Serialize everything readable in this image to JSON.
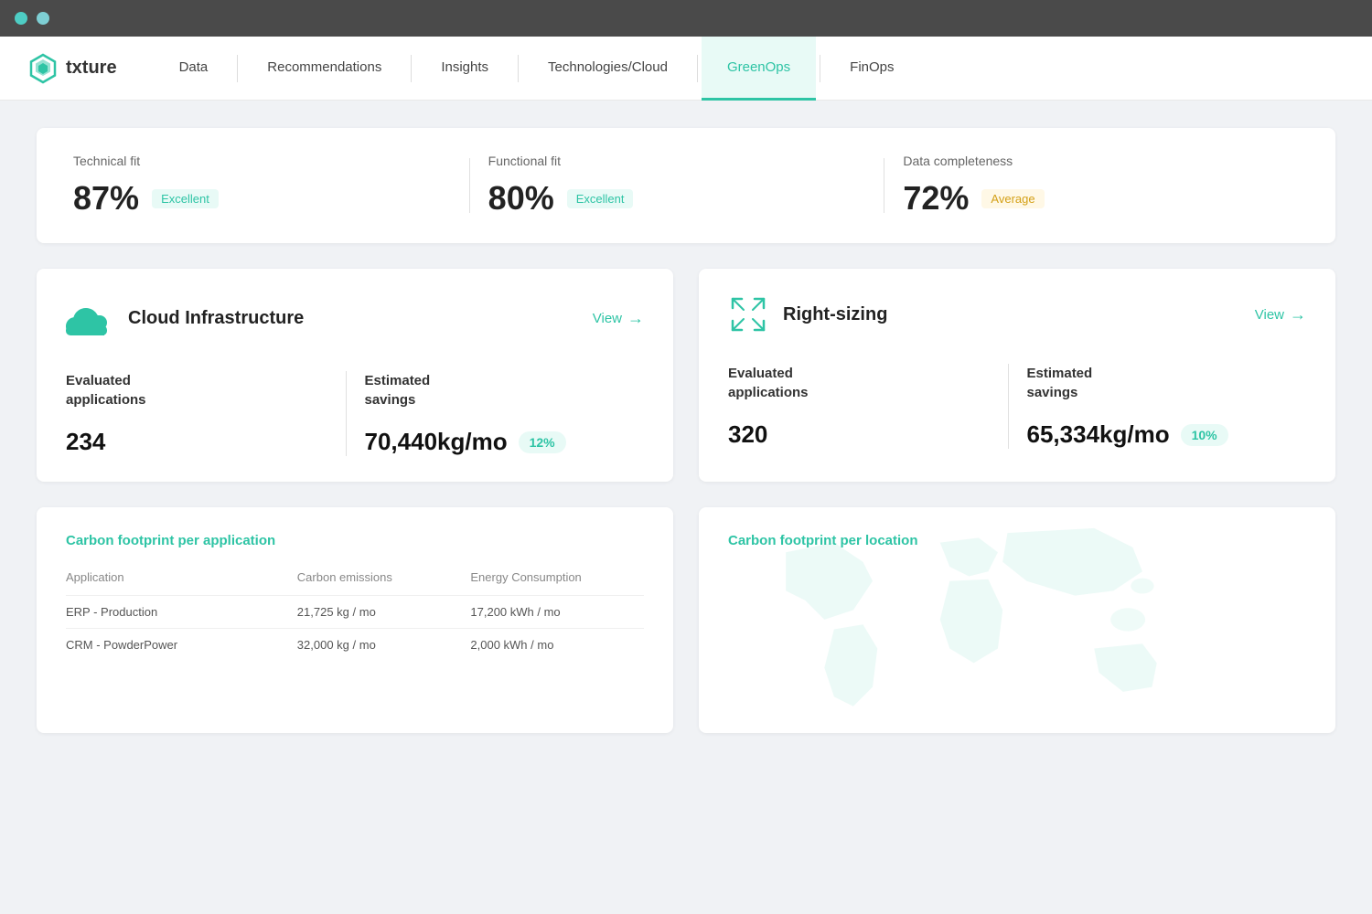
{
  "topbar": {
    "dot1_color": "#4ecdc4",
    "dot2_color": "#7ecfd4"
  },
  "nav": {
    "logo_text": "txture",
    "items": [
      {
        "label": "Data",
        "active": false
      },
      {
        "label": "Recommendations",
        "active": false
      },
      {
        "label": "Insights",
        "active": false
      },
      {
        "label": "Technologies/Cloud",
        "active": false
      },
      {
        "label": "GreenOps",
        "active": true
      },
      {
        "label": "FinOps",
        "active": false
      }
    ]
  },
  "stats_card": {
    "technical_fit_label": "Technical fit",
    "technical_fit_value": "87%",
    "technical_fit_badge": "Excellent",
    "functional_fit_label": "Functional fit",
    "functional_fit_value": "80%",
    "functional_fit_badge": "Excellent",
    "data_completeness_label": "Data completeness",
    "data_completeness_value": "72%",
    "data_completeness_badge": "Average"
  },
  "cloud_infra": {
    "title": "Cloud Infrastructure",
    "view_label": "View",
    "eval_apps_label": "Evaluated\napplications",
    "eval_apps_value": "234",
    "est_savings_label": "Estimated\nsavings",
    "est_savings_value": "70,440kg/mo",
    "est_savings_badge": "12%"
  },
  "right_sizing": {
    "title": "Right-sizing",
    "view_label": "View",
    "eval_apps_label": "Evaluated\napplications",
    "eval_apps_value": "320",
    "est_savings_label": "Estimated\nsavings",
    "est_savings_value": "65,334kg/mo",
    "est_savings_badge": "10%"
  },
  "carbon_app": {
    "title": "Carbon footprint per application",
    "col_application": "Application",
    "col_carbon": "Carbon emissions",
    "col_energy": "Energy Consumption",
    "rows": [
      {
        "app": "ERP - Production",
        "carbon": "21,725 kg / mo",
        "energy": "17,200 kWh / mo"
      },
      {
        "app": "CRM - PowderPower",
        "carbon": "32,000 kg / mo",
        "energy": "2,000 kWh / mo"
      }
    ]
  },
  "carbon_location": {
    "title": "Carbon footprint per location"
  }
}
